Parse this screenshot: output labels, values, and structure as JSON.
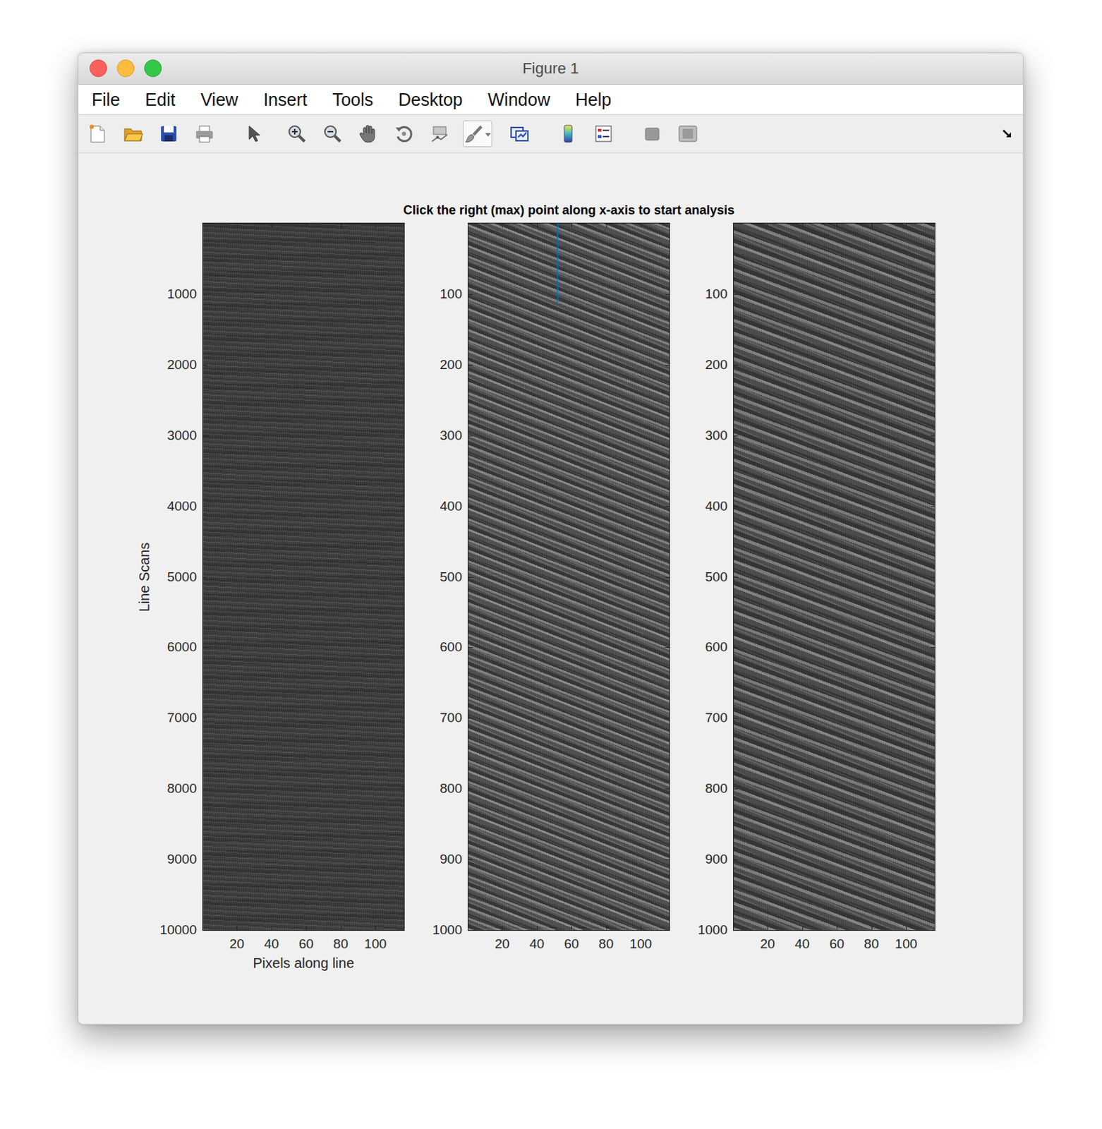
{
  "window": {
    "title": "Figure 1"
  },
  "menu": [
    "File",
    "Edit",
    "View",
    "Insert",
    "Tools",
    "Desktop",
    "Window",
    "Help"
  ],
  "toolbar": [
    {
      "kind": "new",
      "selected": false
    },
    {
      "kind": "open",
      "selected": false
    },
    {
      "kind": "save",
      "selected": false
    },
    {
      "kind": "print",
      "selected": false
    },
    {
      "kind": "select",
      "selected": false
    },
    {
      "kind": "zoomin",
      "selected": false
    },
    {
      "kind": "zoomout",
      "selected": false
    },
    {
      "kind": "pan",
      "selected": false
    },
    {
      "kind": "rotate",
      "selected": false
    },
    {
      "kind": "datacursor",
      "selected": false
    },
    {
      "kind": "brush",
      "selected": true
    },
    {
      "kind": "link",
      "selected": false
    },
    {
      "kind": "colorbar",
      "selected": false
    },
    {
      "kind": "legend",
      "selected": false
    },
    {
      "kind": "hide",
      "selected": false
    },
    {
      "kind": "show",
      "selected": false
    }
  ],
  "figure": {
    "title": "Click the right (max) point along x-axis to start analysis",
    "axes": [
      {
        "ylabel": "Line Scans",
        "xlabel": "Pixels along line",
        "yticks": [
          "1000",
          "2000",
          "3000",
          "4000",
          "5000",
          "6000",
          "7000",
          "8000",
          "9000",
          "10000"
        ],
        "xticks": [
          "20",
          "40",
          "60",
          "80",
          "100"
        ],
        "lines": []
      },
      {
        "ylabel": "",
        "xlabel": "",
        "yticks": [
          "100",
          "200",
          "300",
          "400",
          "500",
          "600",
          "700",
          "800",
          "900",
          "1000"
        ],
        "xticks": [
          "20",
          "40",
          "60",
          "80",
          "100"
        ],
        "lines": [
          {
            "x": [
              52,
              52
            ],
            "y": [
              0,
              113
            ],
            "color": "#0072bd"
          }
        ]
      },
      {
        "ylabel": "",
        "xlabel": "",
        "yticks": [
          "100",
          "200",
          "300",
          "400",
          "500",
          "600",
          "700",
          "800",
          "900",
          "1000"
        ],
        "xticks": [
          "20",
          "40",
          "60",
          "80",
          "100"
        ],
        "lines": []
      }
    ]
  }
}
